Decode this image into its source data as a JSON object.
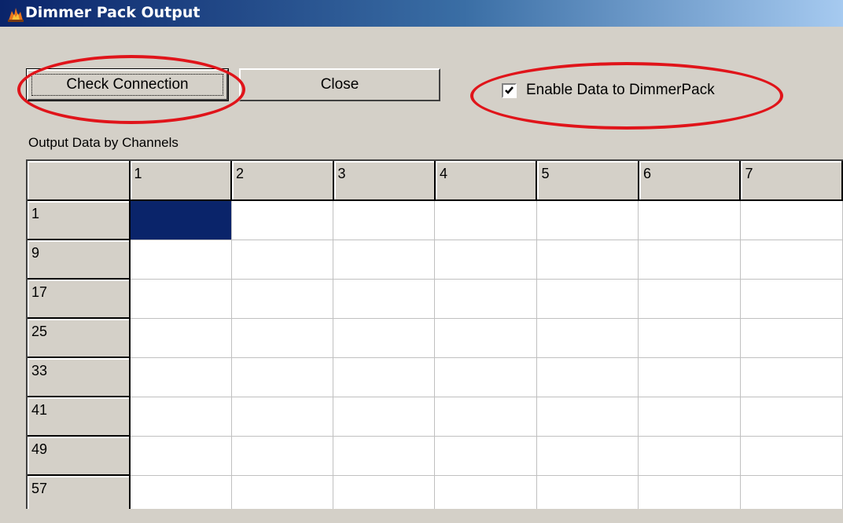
{
  "window": {
    "title": "Dimmer Pack Output",
    "icon": "app-icon"
  },
  "buttons": {
    "check_connection": "Check Connection",
    "close": "Close"
  },
  "enable_checkbox": {
    "label": "Enable Data to DimmerPack",
    "checked": true
  },
  "grid": {
    "label": "Output Data by Channels",
    "column_headers": [
      "1",
      "2",
      "3",
      "4",
      "5",
      "6",
      "7"
    ],
    "row_headers": [
      "1",
      "9",
      "17",
      "25",
      "33",
      "41",
      "49",
      "57"
    ],
    "selected_cell": {
      "row": 0,
      "col": 0
    }
  },
  "colors": {
    "selection": "#0a246a",
    "annotation": "#e0141a",
    "face": "#d4d0c8"
  }
}
